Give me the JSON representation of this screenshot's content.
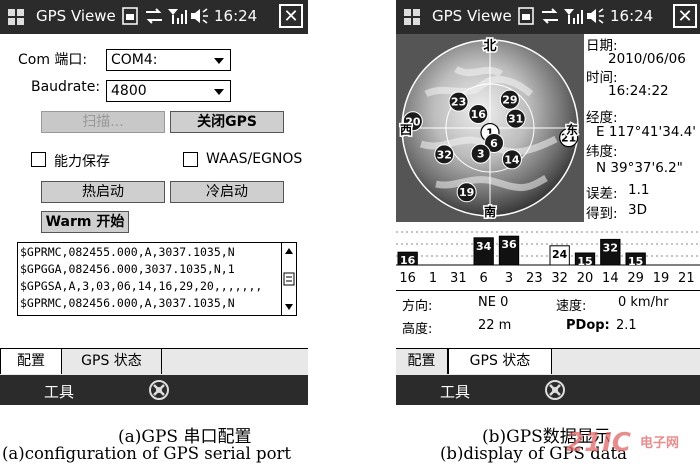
{
  "left": {
    "title": "GPS Viewe",
    "time": "16:24",
    "close_label": "✕",
    "com_label": "Com 端口:",
    "com_value": "COM4:",
    "baud_label": "Baudrate:",
    "baud_value": "4800",
    "scan_label": "扫描...",
    "close_gps_label": "关闭GPS",
    "power_save_label": "能力保存",
    "waas_label": "WAAS/EGNOS",
    "hot_start_label": "热启动",
    "cold_start_label": "冷启动",
    "warm_start_label": "Warm 开始",
    "nmea_lines": [
      "$GPRMC,082455.000,A,3037.1035,N",
      "$GPGGA,082456.000,3037.1035,N,1",
      "$GPGSA,A,3,03,06,14,16,29,20,,,,,,,",
      "$GPRMC,082456.000,A,3037.1035,N"
    ],
    "tabs": [
      "配置",
      "GPS 状态"
    ],
    "softkey": "工具"
  },
  "right": {
    "title": "GPS Viewe",
    "time": "16:24",
    "close_label": "✕",
    "date_label": "日期:",
    "date_value": "2010/06/06",
    "time_label": "时间:",
    "time_value": "16:24:22",
    "lon_label": "经度:",
    "lon_value": "E 117°41'34.4'",
    "lat_label": "纬度:",
    "lat_value": "N  39°37'6.2\"",
    "err_label": "误差:",
    "err_value": "1.1",
    "fix_label": "得到:",
    "fix_value": "3D",
    "compass": {
      "north": "北",
      "south": "南",
      "west": "西",
      "east": "东"
    },
    "satellites": [
      {
        "id": "29",
        "el": 52,
        "az": 35,
        "style": "dark"
      },
      {
        "id": "23",
        "el": 45,
        "az": 310,
        "style": "dark"
      },
      {
        "id": "31",
        "el": 60,
        "az": 70,
        "style": "dark"
      },
      {
        "id": "16",
        "el": 70,
        "az": 320,
        "style": "dark"
      },
      {
        "id": "20",
        "el": 5,
        "az": 275,
        "style": "dark"
      },
      {
        "id": "21",
        "el": 3,
        "az": 97,
        "style": "white"
      },
      {
        "id": "1",
        "el": 85,
        "az": 180,
        "style": "white"
      },
      {
        "id": "6",
        "el": 73,
        "az": 165,
        "style": "dark"
      },
      {
        "id": "32",
        "el": 32,
        "az": 240,
        "style": "dark"
      },
      {
        "id": "3",
        "el": 60,
        "az": 200,
        "style": "dark"
      },
      {
        "id": "14",
        "el": 48,
        "az": 145,
        "style": "dark"
      },
      {
        "id": "19",
        "el": 15,
        "az": 200,
        "style": "dark"
      }
    ],
    "snr_bars": [
      {
        "id": "16",
        "snr": 16,
        "used": true
      },
      {
        "id": "1",
        "snr": 0,
        "used": false
      },
      {
        "id": "31",
        "snr": 0,
        "used": false
      },
      {
        "id": "6",
        "snr": 34,
        "used": true
      },
      {
        "id": "3",
        "snr": 36,
        "used": true
      },
      {
        "id": "23",
        "snr": 0,
        "used": false
      },
      {
        "id": "32",
        "snr": 24,
        "used": false
      },
      {
        "id": "20",
        "snr": 15,
        "used": true
      },
      {
        "id": "14",
        "snr": 32,
        "used": true
      },
      {
        "id": "29",
        "snr": 15,
        "used": true
      },
      {
        "id": "19",
        "snr": 0,
        "used": false
      },
      {
        "id": "21",
        "snr": 0,
        "used": false
      }
    ],
    "heading_label": "方向:",
    "heading_value": "NE 0",
    "speed_label": "速度:",
    "speed_value": "0 km/hr",
    "alt_label": "高度:",
    "alt_value": "22 m",
    "pdop_label": "PDop:",
    "pdop_value": "2.1",
    "tabs": [
      "配置",
      "GPS 状态"
    ],
    "softkey": "工具"
  },
  "captions": {
    "left_cn": "(a)GPS 串口配置",
    "left_en": "(a)configuration of GPS serial port",
    "right_cn": "(b)GPS数据显示",
    "right_en": "(b)display of GPS data"
  },
  "watermark": {
    "logo": "21IC",
    "site": "电子网"
  }
}
